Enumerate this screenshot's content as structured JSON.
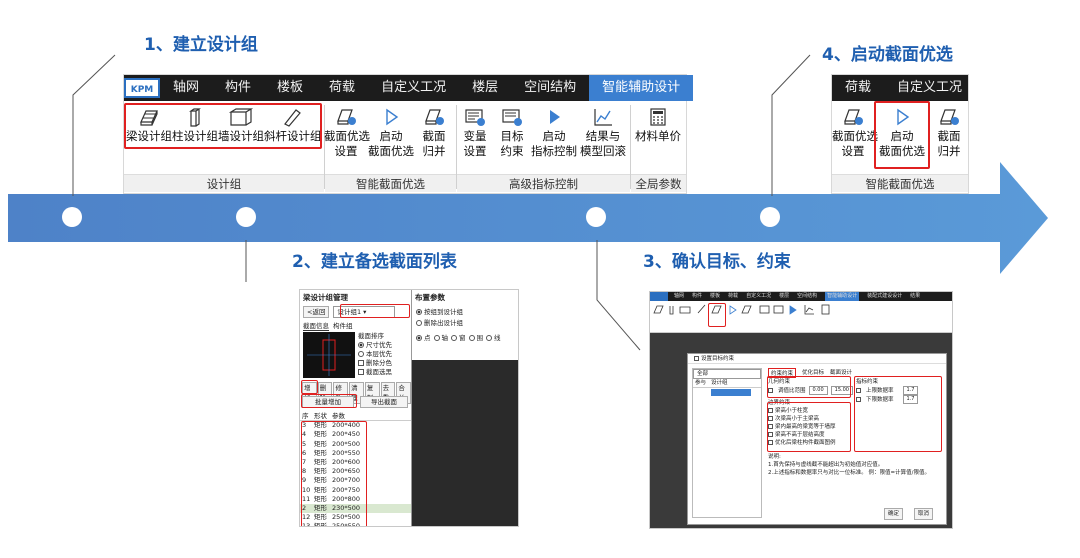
{
  "steps": {
    "s1": "1、建立设计组",
    "s2": "2、建立备选截面列表",
    "s3": "3、确认目标、约束",
    "s4": "4、启动截面优选"
  },
  "colors": {
    "arrow": "#4a8bd0",
    "highlight": "#e02020",
    "active_tab": "#3b7fd0",
    "title": "#1f5fb0"
  },
  "ribbon_main": {
    "logo": "KPM",
    "tabs": [
      "轴网",
      "构件",
      "楼板",
      "荷载",
      "自定义工况",
      "楼层",
      "空间结构",
      "智能辅助设计"
    ],
    "tools": {
      "beam": "梁设计组",
      "column": "柱设计组",
      "wall": "墙设计组",
      "brace": "斜杆设计组",
      "sect_set_1": "截面优选",
      "sect_set_2": "设置",
      "sect_start_1": "启动",
      "sect_start_2": "截面优选",
      "sect_merge_1": "截面",
      "sect_merge_2": "归并",
      "var_1": "变量",
      "var_2": "设置",
      "goal_1": "目标",
      "goal_2": "约束",
      "idx_1": "启动",
      "idx_2": "指标控制",
      "res_1": "结果与",
      "res_2": "模型回滚",
      "mat": "材料单价"
    },
    "groups": [
      "设计组",
      "智能截面优选",
      "高级指标控制",
      "全局参数"
    ]
  },
  "ribbon_small": {
    "tabs": [
      "荷载",
      "自定义工况"
    ],
    "tools": {
      "set_1": "截面优选",
      "set_2": "设置",
      "start_1": "启动",
      "start_2": "截面优选",
      "merge_1": "截面",
      "merge_2": "归并"
    },
    "group": "智能截面优选"
  },
  "panel2": {
    "title": "梁设计组管理",
    "back": "<返回",
    "group_sel": "设计组1",
    "tab_a": "截面信息",
    "tab_b": "构件组",
    "sort_title": "截面排序",
    "sort_opts": [
      "尺寸优先",
      "本层优先"
    ],
    "chk_opts": [
      "删除分色",
      "截面选黑"
    ],
    "toolbar": [
      "增加",
      "删除",
      "修改",
      "清理",
      "复制",
      "去重",
      "合并"
    ],
    "batch_add": "批量增加",
    "export": "导出截面",
    "cols": [
      "序",
      "形状",
      "参数"
    ],
    "rows": [
      [
        "3",
        "矩形",
        "200*400"
      ],
      [
        "4",
        "矩形",
        "200*450"
      ],
      [
        "5",
        "矩形",
        "200*500"
      ],
      [
        "6",
        "矩形",
        "200*550"
      ],
      [
        "7",
        "矩形",
        "200*600"
      ],
      [
        "8",
        "矩形",
        "200*650"
      ],
      [
        "9",
        "矩形",
        "200*700"
      ],
      [
        "10",
        "矩形",
        "200*750"
      ],
      [
        "11",
        "矩形",
        "200*800"
      ],
      [
        "2",
        "矩形",
        "230*500"
      ],
      [
        "12",
        "矩形",
        "250*500"
      ],
      [
        "13",
        "矩形",
        "250*550"
      ]
    ],
    "layout_title": "布置参数",
    "layout_opts": [
      "按组到设计组",
      "删除出设计组"
    ],
    "mode_opts": [
      "点",
      "轴",
      "窗",
      "围",
      "线"
    ]
  },
  "panel3": {
    "tabs": [
      "轴网",
      "构件",
      "楼板",
      "荷载",
      "自定义工况",
      "楼层",
      "空间结构",
      "智能辅助设计",
      "装配式建设设计",
      "结果"
    ],
    "dialog_title": "设置目标约束",
    "left_sel": "全部",
    "left_cols": [
      "参与",
      "设计组"
    ],
    "tab_a": "约束约束",
    "tab_b": "优化目标",
    "tab_c": "截面设计",
    "geo_title": "几何约束",
    "geo_item": "调值比范围",
    "geo_lo": "0.00",
    "geo_hi": "15.00",
    "idx_title": "指标约束",
    "idx_items": [
      "上限数据率",
      "下限数据率"
    ],
    "idx_val": "1.7",
    "edge_title": "边界约束",
    "edge_items": [
      "梁高小于柱宽",
      "次梁高小于主梁高",
      "梁内最高的梁宽等于墙厚",
      "梁高不高于层结高度",
      "优化后梁柱构件截面图例"
    ],
    "note_title": "说明:",
    "note_lines": [
      "1.首先保持与虚线截不能超出为初始值对应值。",
      "2.上述指标和数据率只与对比一位标准。    例：限值=计算值/限值。"
    ],
    "ok": "确定",
    "cancel": "取消"
  }
}
